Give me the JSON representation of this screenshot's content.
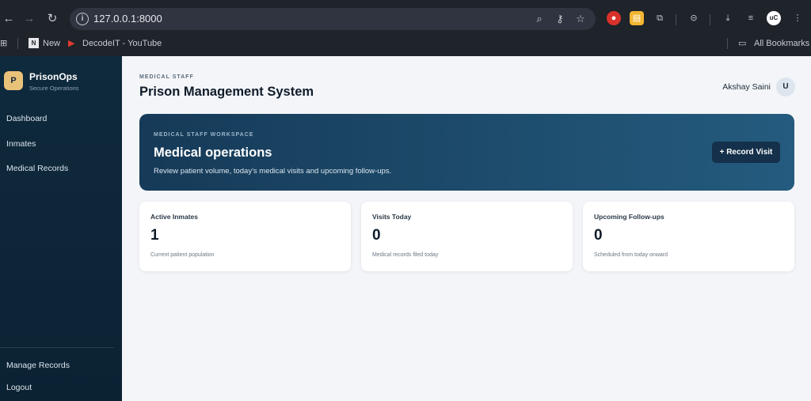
{
  "browser": {
    "url": "127.0.0.1:8000",
    "bookmarks": [
      {
        "label": "New"
      },
      {
        "label": "DecodeIT - YouTube"
      }
    ],
    "all_bookmarks": "All Bookmarks",
    "profile_initials": "uC"
  },
  "sidebar": {
    "logo_letter": "P",
    "brand": "PrisonOps",
    "brand_sub": "Secure Operations",
    "items": [
      {
        "label": "Dashboard"
      },
      {
        "label": "Inmates"
      },
      {
        "label": "Medical Records"
      }
    ],
    "bottom_items": [
      {
        "label": "Manage Records"
      },
      {
        "label": "Logout"
      }
    ]
  },
  "header": {
    "eyebrow": "MEDICAL STAFF",
    "title": "Prison Management System",
    "user_name": "Akshay Saini",
    "avatar_letter": "U"
  },
  "hero": {
    "eyebrow": "MEDICAL STAFF WORKSPACE",
    "title": "Medical operations",
    "description": "Review patient volume, today's medical visits and upcoming follow-ups.",
    "button": "+ Record Visit"
  },
  "stats": [
    {
      "label": "Active Inmates",
      "value": "1",
      "caption": "Current patient population"
    },
    {
      "label": "Visits Today",
      "value": "0",
      "caption": "Medical records filed today"
    },
    {
      "label": "Upcoming Follow-ups",
      "value": "0",
      "caption": "Scheduled from today onward"
    }
  ],
  "colors": {
    "sidebar": "#0f2a3d",
    "hero_start": "#163a58",
    "hero_end": "#245b7e",
    "logo": "#e9c27a"
  }
}
